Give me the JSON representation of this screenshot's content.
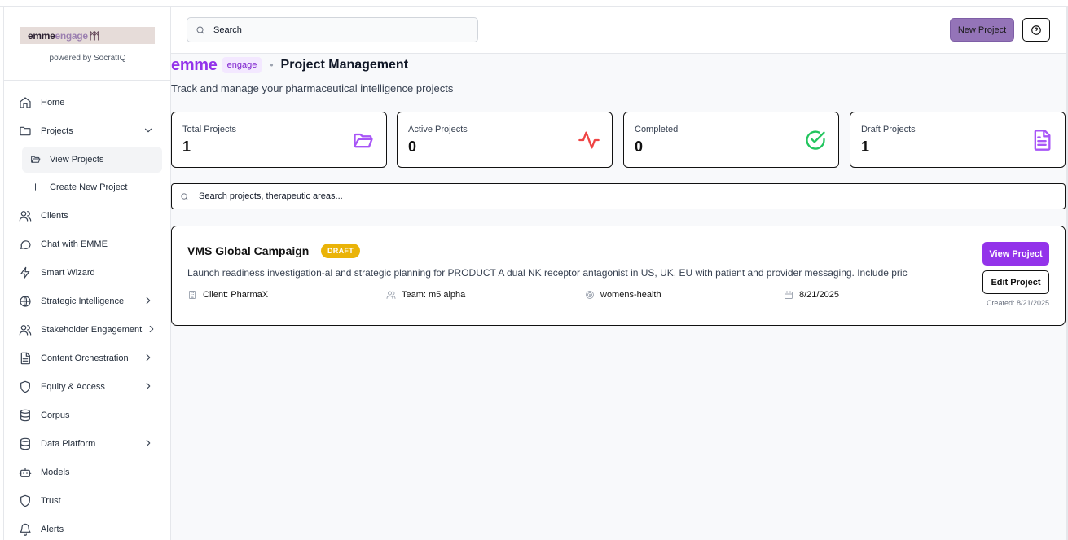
{
  "sidebar": {
    "logo_text_1": "emme",
    "logo_text_2": "engage",
    "logo_mark": "ꟿ",
    "powered_by": "powered by SocratIQ",
    "items": [
      {
        "label": "Home",
        "icon": "home-icon"
      },
      {
        "label": "Projects",
        "icon": "folder-icon",
        "expanded": true
      },
      {
        "label": "View Projects",
        "icon": "folder-open-icon",
        "active": true
      },
      {
        "label": "Create New Project",
        "icon": "plus-icon"
      },
      {
        "label": "Clients",
        "icon": "users-icon"
      },
      {
        "label": "Chat with EMME",
        "icon": "chat-icon"
      },
      {
        "label": "Smart Wizard",
        "icon": "zap-icon"
      },
      {
        "label": "Strategic Intelligence",
        "icon": "globe-icon"
      },
      {
        "label": "Stakeholder Engagement",
        "icon": "users-icon"
      },
      {
        "label": "Content Orchestration",
        "icon": "document-icon"
      },
      {
        "label": "Equity & Access",
        "icon": "shield-icon"
      },
      {
        "label": "Corpus",
        "icon": "database-icon"
      },
      {
        "label": "Data Platform",
        "icon": "database-icon"
      },
      {
        "label": "Models",
        "icon": "bot-icon"
      },
      {
        "label": "Trust",
        "icon": "shield-icon"
      },
      {
        "label": "Alerts",
        "icon": "bell-icon"
      }
    ]
  },
  "header": {
    "search_placeholder": "Search",
    "new_project_label": "New Project",
    "help_icon": "help-icon"
  },
  "page": {
    "brand": "emme",
    "badge": "engage",
    "separator": "•",
    "title": "Project Management",
    "subtitle": "Track and manage your pharmaceutical intelligence projects"
  },
  "stats": [
    {
      "label": "Total Projects",
      "value": "1",
      "icon": "folder-icon",
      "color": "#a855f7"
    },
    {
      "label": "Active Projects",
      "value": "0",
      "icon": "activity-icon",
      "color": "#ef4444"
    },
    {
      "label": "Completed",
      "value": "0",
      "icon": "check-circle-icon",
      "color": "#22c55e"
    },
    {
      "label": "Draft Projects",
      "value": "1",
      "icon": "file-text-icon",
      "color": "#a855f7"
    }
  ],
  "project_search_placeholder": "Search projects, therapeutic areas...",
  "project": {
    "title": "VMS Global Campaign",
    "status": "DRAFT",
    "description": "Launch readiness investigation-al and strategic planning for PRODUCT A dual NK receptor antagonist in US, UK, EU with patient and provider messaging. Include pric",
    "client": "Client: PharmaX",
    "team": "Team: m5 alpha",
    "area": "womens-health",
    "date": "8/21/2025",
    "created": "Created: 8/21/2025",
    "view_label": "View Project",
    "edit_label": "Edit Project"
  }
}
